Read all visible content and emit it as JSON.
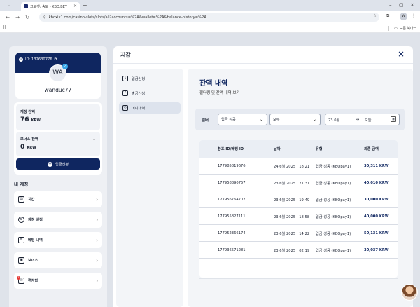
{
  "browser": {
    "tab_title": "크로켓: 송토 - KBO.BET",
    "url": "kboxix1.com/casino-slots/slots/all?accounts=%2A&wallet=%2A&balance-history=%2A",
    "profile_initials": "W",
    "bookmarks_label": "모든 북마크"
  },
  "profile": {
    "id_label": "ID: 132630776",
    "initials": "WA",
    "name": "wanduc77"
  },
  "balance": {
    "account_label": "계정 잔액",
    "account_value": "76",
    "account_currency": "KRW",
    "bonus_label": "보너스 잔액",
    "bonus_value": "0",
    "bonus_currency": "KRW",
    "deposit_label": "입금신청"
  },
  "sidebar": {
    "section_title": "내 계정",
    "items": [
      {
        "label": "지갑",
        "icon": "wallet-icon"
      },
      {
        "label": "계정 설정",
        "icon": "settings-icon"
      },
      {
        "label": "베팅 내역",
        "icon": "bet-history-icon"
      },
      {
        "label": "보너스",
        "icon": "gift-icon"
      },
      {
        "label": "편지함",
        "icon": "mail-icon",
        "badge": "1"
      }
    ]
  },
  "modal": {
    "title": "지갑",
    "subnav": [
      {
        "label": "입금신청",
        "icon": "deposit-icon",
        "active": false
      },
      {
        "label": "출금신청",
        "icon": "withdraw-icon",
        "active": false
      },
      {
        "label": "머니내역",
        "icon": "history-icon",
        "active": true
      }
    ],
    "content_title": "잔액 내역",
    "content_subtitle": "필터링 및 잔액 내역 보기",
    "filter": {
      "label": "필터",
      "type_value": "입금 성공",
      "status_value": "모두",
      "date_from": "23 6월",
      "date_to": "오늘",
      "arrow": "↔"
    },
    "table": {
      "headers": [
        "참조 ID/베팅 ID",
        "날짜",
        "유형",
        "최종 금액"
      ],
      "rows": [
        [
          "177985819676",
          "24 6월 2025 | 18:21",
          "입금 성공 (KBOpay1)",
          "30,311 KRW"
        ],
        [
          "177958890757",
          "23 6월 2025 | 21:31",
          "입금 성공 (KBOpay1)",
          "40,010 KRW"
        ],
        [
          "177956764702",
          "23 6월 2025 | 19:49",
          "입금 성공 (KBOpay1)",
          "30,000 KRW"
        ],
        [
          "177955827111",
          "23 6월 2025 | 18:58",
          "입금 성공 (KBOpay1)",
          "40,000 KRW"
        ],
        [
          "177952366174",
          "23 6월 2025 | 14:22",
          "입금 성공 (KBOpay1)",
          "50,131 KRW"
        ],
        [
          "177936571281",
          "23 6월 2025 | 02:19",
          "입금 성공 (KBOpay1)",
          "30,037 KRW"
        ]
      ]
    }
  },
  "colors": {
    "brand_navy": "#0f2660",
    "accent_blue": "#3aa7e8"
  }
}
